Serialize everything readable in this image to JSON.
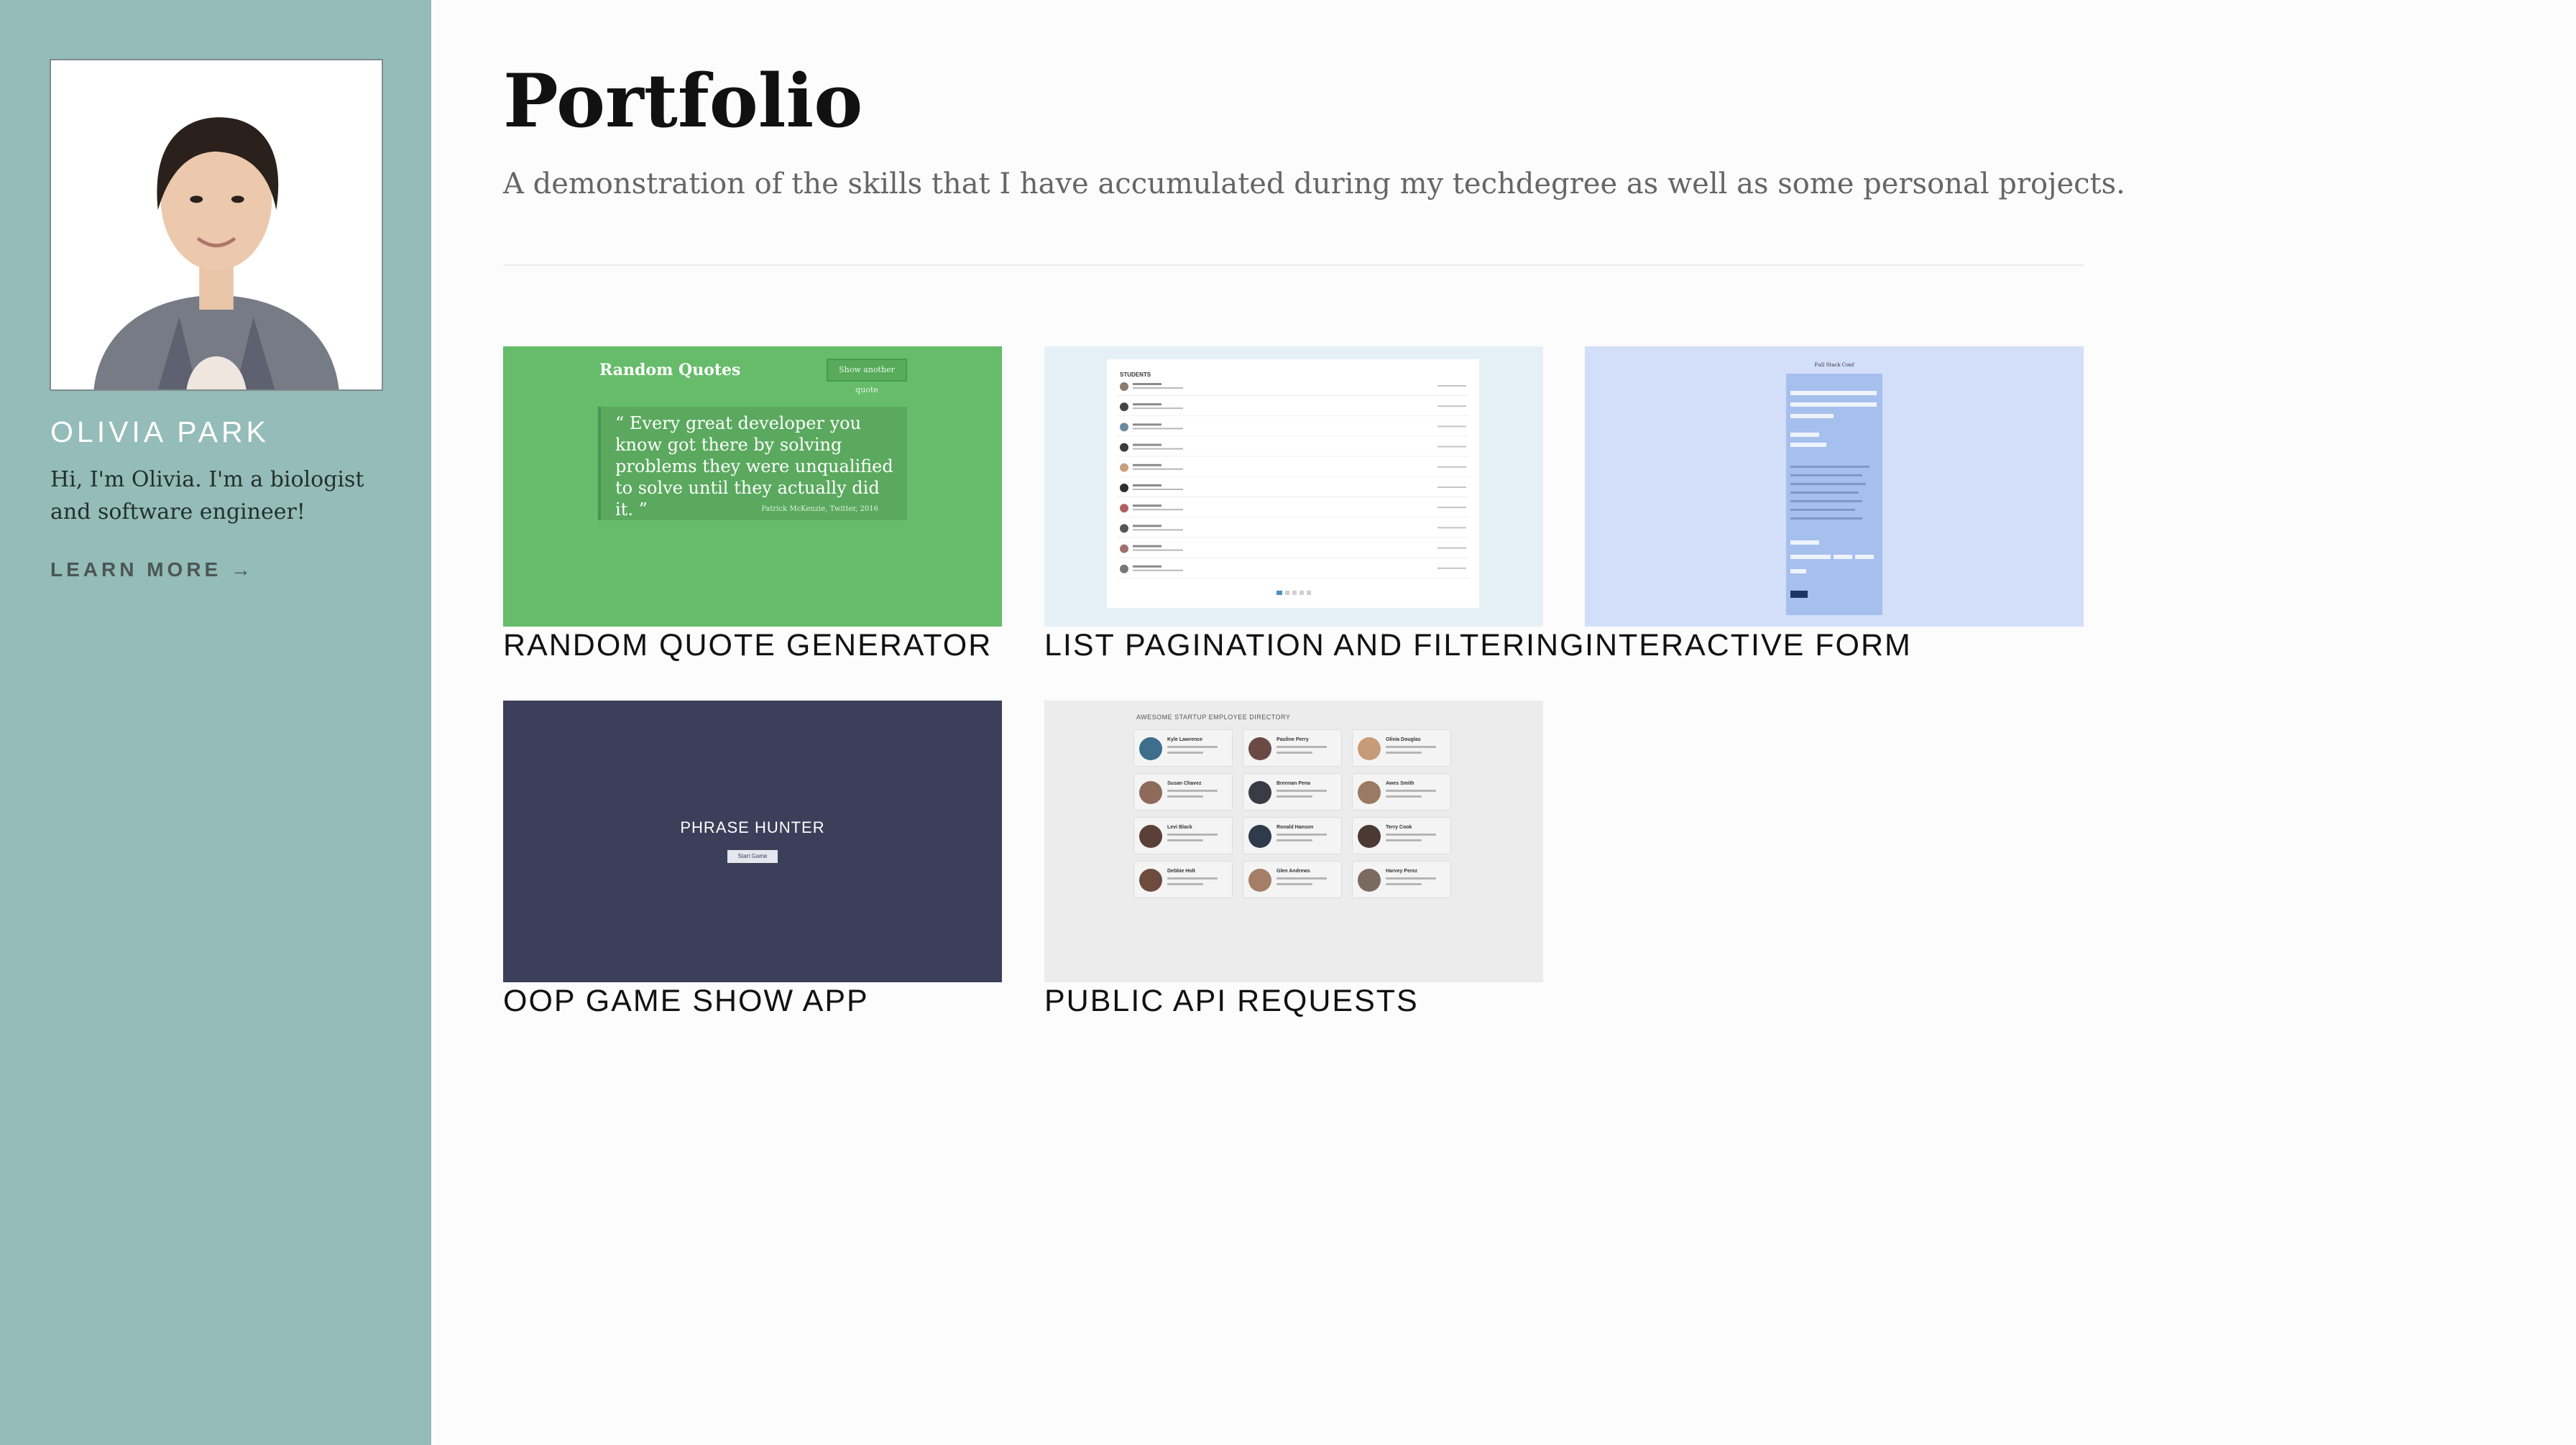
{
  "sidebar": {
    "name": "OLIVIA PARK",
    "bio": "Hi, I'm Olivia. I'm a biologist and software engineer!",
    "learn_more": "LEARN MORE →"
  },
  "main": {
    "title": "Portfolio",
    "subtitle": "A demonstration of the skills that I have accumulated during my techdegree as well as some personal projects.",
    "projects": [
      {
        "label": "RANDOM QUOTE GENERATOR",
        "thumb": {
          "heading": "Random Quotes",
          "button": "Show another quote",
          "quote": "“ Every great developer you know got there by solving problems they were unqualified to solve until they actually did it. ”",
          "source": "Patrick McKenzie, Twitter, 2016"
        }
      },
      {
        "label": "LIST PAGINATION AND FILTERING",
        "thumb": {
          "heading": "STUDENTS"
        }
      },
      {
        "label": "INTERACTIVE FORM",
        "thumb": {
          "heading": "Full Stack Conf"
        }
      },
      {
        "label": "OOP GAME SHOW APP",
        "thumb": {
          "heading": "PHRASE HUNTER",
          "button": "Start Game"
        }
      },
      {
        "label": "PUBLIC API REQUESTS",
        "thumb": {
          "heading": "AWESOME STARTUP EMPLOYEE DIRECTORY",
          "employees": [
            "Kyle Lawrence",
            "Pauline Perry",
            "Olivia Douglas",
            "Susan Chavez",
            "Brennan Pena",
            "Awes Smith",
            "Levi Black",
            "Ronald Hanson",
            "Terry Cook",
            "Debbie Holt",
            "Glen Andrews",
            "Harvey Perez"
          ]
        }
      }
    ]
  },
  "colors": {
    "sidebar_bg": "#94bcb9",
    "quote_thumb": "#66bc6a",
    "list_thumb": "#e5f0f6",
    "form_thumb": "#d3dff8",
    "game_thumb": "#3c3f59",
    "directory_thumb": "#ececec"
  },
  "icons": {
    "avatar": "profile-photo",
    "learn_more_arrow": "arrow-right-icon"
  }
}
